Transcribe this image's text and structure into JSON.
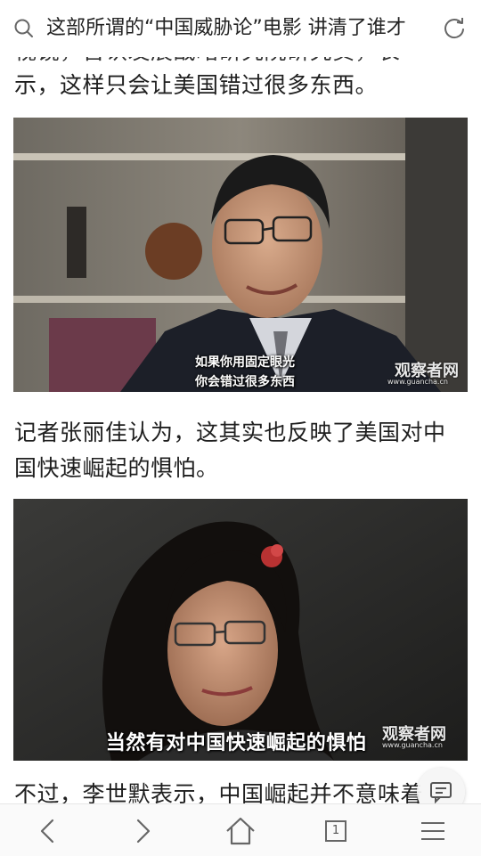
{
  "topbar": {
    "title": "这部所谓的“中国威胁论”电影 讲清了谁才",
    "search_icon": "search-icon",
    "refresh_icon": "refresh-icon"
  },
  "article": {
    "para_cut": "视镜，否认发展战略研究院研究员，表",
    "para1": "示，这样只会让美国错过很多东西。",
    "image1": {
      "subtitle_line1": "如果你用固定眼光",
      "subtitle_line2": "你会错过很多东西",
      "watermark": "观察者网",
      "watermark_url": "www.guancha.cn"
    },
    "para2": "记者张丽佳认为，这其实也反映了美国对中国快速崛起的惧怕。",
    "image2": {
      "subtitle": "当然有对中国快速崛起的惧怕",
      "watermark": "观察者网",
      "watermark_url": "www.guancha.cn"
    },
    "para3": "不过，李世默表示，中国崛起并不意味着"
  },
  "bottom_nav": {
    "tab_count": "1"
  },
  "colors": {
    "background": "#ffffff",
    "text": "#1f1f1f",
    "nav_icon": "#666666"
  }
}
